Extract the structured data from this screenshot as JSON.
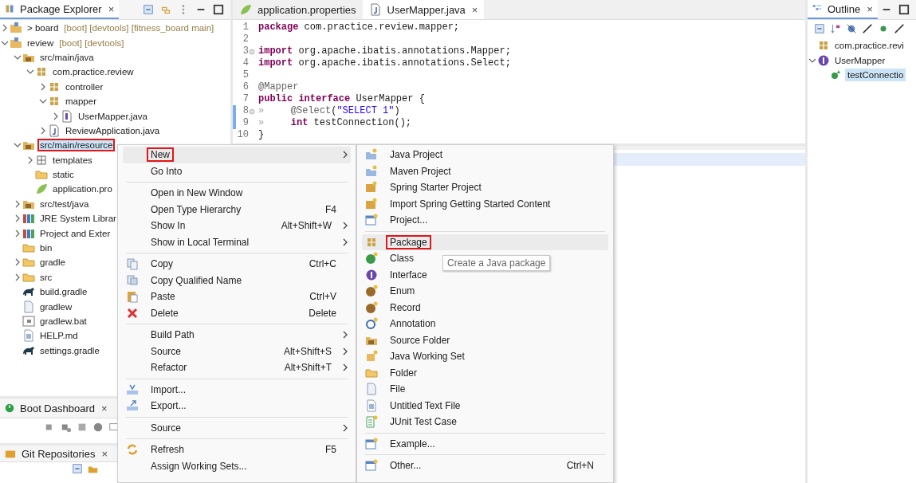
{
  "package_explorer": {
    "title": "Package Explorer",
    "close": "×",
    "tree": [
      {
        "label": "> board",
        "decoration": "[boot] [devtools] [fitness_board main]",
        "kind": "project",
        "expanded": false
      },
      {
        "label": "review",
        "decoration": "[boot] [devtools]",
        "kind": "project",
        "expanded": true,
        "children": [
          {
            "label": "src/main/java",
            "kind": "source-folder",
            "expanded": true,
            "children": [
              {
                "label": "com.practice.review",
                "kind": "package",
                "expanded": true,
                "children": [
                  {
                    "label": "controller",
                    "kind": "package",
                    "expanded": false
                  },
                  {
                    "label": "mapper",
                    "kind": "package",
                    "expanded": true,
                    "children": [
                      {
                        "label": "UserMapper.java",
                        "kind": "interface-file",
                        "expanded": false
                      }
                    ]
                  },
                  {
                    "label": "ReviewApplication.java",
                    "kind": "java",
                    "expanded": false
                  }
                ]
              }
            ]
          },
          {
            "label": "src/main/resource",
            "kind": "source-folder",
            "expanded": true,
            "selected": true,
            "highlighted": true,
            "children": [
              {
                "label": "templates",
                "kind": "package-empty",
                "expanded": false
              },
              {
                "label": "static",
                "kind": "folder"
              },
              {
                "label": "application.pro",
                "kind": "leaf"
              }
            ]
          },
          {
            "label": "src/test/java",
            "kind": "source-folder",
            "expanded": false
          },
          {
            "label": "JRE System Librar",
            "kind": "library",
            "expanded": false
          },
          {
            "label": "Project and Exter",
            "kind": "library",
            "expanded": false
          },
          {
            "label": "bin",
            "kind": "folder"
          },
          {
            "label": "gradle",
            "kind": "folder",
            "expanded": false
          },
          {
            "label": "src",
            "kind": "folder",
            "expanded": false
          },
          {
            "label": "build.gradle",
            "kind": "gradle"
          },
          {
            "label": "gradlew",
            "kind": "file"
          },
          {
            "label": "gradlew.bat",
            "kind": "bat"
          },
          {
            "label": "HELP.md",
            "kind": "md"
          },
          {
            "label": "settings.gradle",
            "kind": "gradle"
          }
        ]
      }
    ]
  },
  "boot_dashboard": {
    "title": "Boot Dashboard",
    "close": "×"
  },
  "git_repositories": {
    "title": "Git Repositories",
    "close": "×"
  },
  "editor": {
    "tabs": [
      {
        "label": "application.properties",
        "kind": "leaf",
        "selected": false
      },
      {
        "label": "UserMapper.java",
        "kind": "java",
        "selected": true,
        "close": "×"
      }
    ],
    "lines": [
      {
        "number": "1",
        "tokens": [
          {
            "kind": "kw",
            "text": "package"
          },
          {
            "kind": "plain",
            "text": " com.practice.review.mapper;"
          }
        ]
      },
      {
        "number": "2"
      },
      {
        "number": "3",
        "fold": true,
        "tokens": [
          {
            "kind": "kw",
            "text": "import"
          },
          {
            "kind": "plain",
            "text": " org.apache.ibatis.annotations.Mapper;"
          }
        ]
      },
      {
        "number": "4",
        "tokens": [
          {
            "kind": "kw",
            "text": "import"
          },
          {
            "kind": "plain",
            "text": " org.apache.ibatis.annotations.Select;"
          }
        ]
      },
      {
        "number": "5"
      },
      {
        "number": "6",
        "tokens": [
          {
            "kind": "ann",
            "text": "@Mapper"
          }
        ]
      },
      {
        "number": "7",
        "tokens": [
          {
            "kind": "kw",
            "text": "public interface"
          },
          {
            "kind": "plain",
            "text": " UserMapper {"
          }
        ]
      },
      {
        "number": "8",
        "fold": true,
        "changed": true,
        "tokens": [
          {
            "kind": "ws",
            "text": "»"
          },
          {
            "kind": "ann",
            "text": "@Select"
          },
          {
            "kind": "plain",
            "text": "("
          },
          {
            "kind": "str",
            "text": "\"SELECT 1\""
          },
          {
            "kind": "plain",
            "text": ")"
          }
        ]
      },
      {
        "number": "9",
        "changed": true,
        "tokens": [
          {
            "kind": "ws",
            "text": "»"
          },
          {
            "kind": "kw",
            "text": "int"
          },
          {
            "kind": "plain",
            "text": " testConnection();"
          }
        ]
      },
      {
        "number": "10",
        "tokens": [
          {
            "kind": "plain",
            "text": "}"
          }
        ]
      }
    ]
  },
  "outline": {
    "title": "Outline",
    "close": "×",
    "tree": [
      {
        "label": "com.practice.revi",
        "kind": "package"
      },
      {
        "label": "UserMapper",
        "kind": "interface",
        "expanded": true,
        "children": [
          {
            "label": "testConnectio",
            "kind": "method",
            "selected": true
          }
        ]
      }
    ]
  },
  "context_menu": {
    "items": [
      {
        "kind": "plain",
        "label": "New",
        "submenu": true,
        "selected": true,
        "highlighted": true
      },
      {
        "kind": "plain",
        "label": "Go Into"
      },
      {
        "kind": "separator"
      },
      {
        "kind": "plain",
        "label": "Open in New Window"
      },
      {
        "kind": "plain",
        "label": "Open Type Hierarchy",
        "shortcut": "F4"
      },
      {
        "kind": "plain",
        "label": "Show In",
        "shortcut": "Alt+Shift+W",
        "submenu": true
      },
      {
        "kind": "plain",
        "label": "Show in Local Terminal",
        "submenu": true
      },
      {
        "kind": "separator"
      },
      {
        "kind": "copy",
        "label": "Copy",
        "shortcut": "Ctrl+C"
      },
      {
        "kind": "copy-name",
        "label": "Copy Qualified Name"
      },
      {
        "kind": "paste",
        "label": "Paste",
        "shortcut": "Ctrl+V"
      },
      {
        "kind": "delete",
        "label": "Delete",
        "shortcut": "Delete"
      },
      {
        "kind": "separator"
      },
      {
        "kind": "plain",
        "label": "Build Path",
        "submenu": true
      },
      {
        "kind": "plain",
        "label": "Source",
        "shortcut": "Alt+Shift+S",
        "submenu": true
      },
      {
        "kind": "plain",
        "label": "Refactor",
        "shortcut": "Alt+Shift+T",
        "submenu": true
      },
      {
        "kind": "separator"
      },
      {
        "kind": "import",
        "label": "Import..."
      },
      {
        "kind": "export",
        "label": "Export..."
      },
      {
        "kind": "separator"
      },
      {
        "kind": "plain",
        "label": "Source",
        "submenu": true
      },
      {
        "kind": "separator"
      },
      {
        "kind": "refresh",
        "label": "Refresh",
        "shortcut": "F5"
      },
      {
        "kind": "plain",
        "label": "Assign Working Sets..."
      }
    ]
  },
  "submenu": {
    "items": [
      {
        "kind": "new-project",
        "label": "Java Project"
      },
      {
        "kind": "new-project",
        "label": "Maven Project"
      },
      {
        "kind": "new-spring",
        "label": "Spring Starter Project"
      },
      {
        "kind": "new-spring",
        "label": "Import Spring Getting Started Content"
      },
      {
        "kind": "new-window",
        "label": "Project..."
      },
      {
        "kind": "separator"
      },
      {
        "kind": "package",
        "label": "Package",
        "selected": true,
        "highlighted": true
      },
      {
        "kind": "class",
        "label": "Class"
      },
      {
        "kind": "interface",
        "label": "Interface"
      },
      {
        "kind": "enum",
        "label": "Enum"
      },
      {
        "kind": "enum",
        "label": "Record"
      },
      {
        "kind": "annotation",
        "label": "Annotation"
      },
      {
        "kind": "source-folder",
        "label": "Source Folder"
      },
      {
        "kind": "working-set",
        "label": "Java Working Set"
      },
      {
        "kind": "folder",
        "label": "Folder"
      },
      {
        "kind": "file",
        "label": "File"
      },
      {
        "kind": "md",
        "label": "Untitled Text File"
      },
      {
        "kind": "junit",
        "label": "JUnit Test Case"
      },
      {
        "kind": "separator"
      },
      {
        "kind": "new-window",
        "label": "Example..."
      },
      {
        "kind": "separator"
      },
      {
        "kind": "new-window",
        "label": "Other...",
        "shortcut": "Ctrl+N"
      }
    ]
  },
  "tooltip": {
    "text": "Create a Java package"
  }
}
